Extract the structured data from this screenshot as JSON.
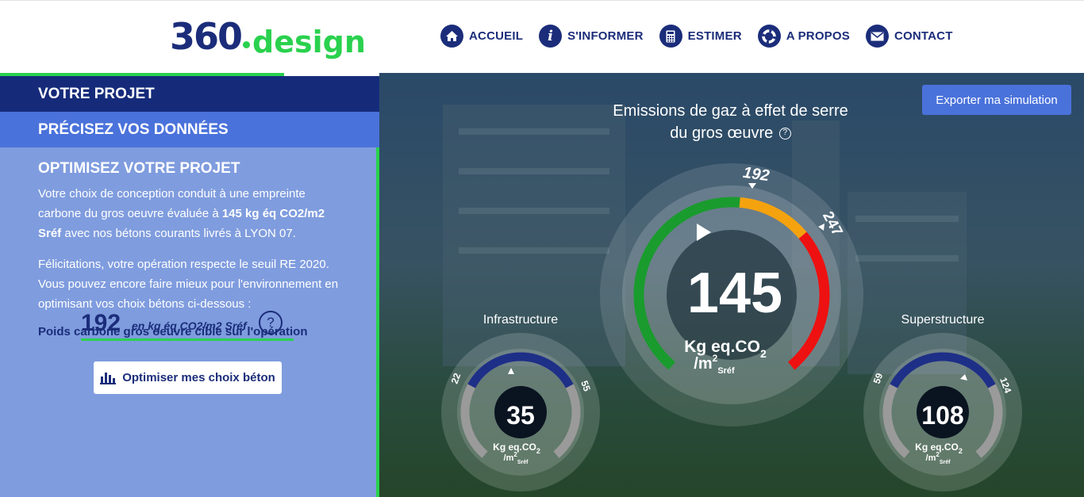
{
  "header": {
    "logo_number": "360",
    "logo_word": "design",
    "nav": [
      {
        "label": "ACCUEIL",
        "icon": "home-icon"
      },
      {
        "label": "S'INFORMER",
        "icon": "info-icon"
      },
      {
        "label": "ESTIMER",
        "icon": "calculator-icon"
      },
      {
        "label": "A PROPOS",
        "icon": "lifebuoy-icon"
      },
      {
        "label": "CONTACT",
        "icon": "mail-icon"
      }
    ]
  },
  "left": {
    "step1": "VOTRE PROJET",
    "step2": "PRÉCISEZ VOS DONNÉES",
    "opt_title": "OPTIMISEZ VOTRE PROJET",
    "p1_a": "Votre choix de conception conduit à une empreinte carbone du gros oeuvre évaluée à ",
    "p1_b": "145 kg éq CO2/m2 Sréf",
    "p1_c": " avec nos bétons courants livrés à LYON 07.",
    "p2": "Félicitations, votre opération respecte le seuil RE 2020. Vous pouvez encore faire mieux pour l'environnement en optimisant vos choix bétons ci-dessous :",
    "cible_label": "Poids carbone gros oeuvre cible sur l'opération",
    "cible_value": "192",
    "cible_unit": "en kg éq CO2/m2 Sréf",
    "help": "?",
    "optim_button": "Optimiser mes choix béton"
  },
  "right": {
    "export_button": "Exporter ma simulation",
    "title_line1": "Emissions de gaz à effet de serre",
    "title_line2": "du gros œuvre",
    "help_small": "?",
    "main_gauge": {
      "value": "145",
      "unit": "Kg eq.CO",
      "unit_sub": "2",
      "unit2": "/m",
      "unit2_sup": "2",
      "unit2_sub": "Sréf",
      "threshold_1": "192",
      "threshold_2": "247",
      "colors": {
        "green": "#1a9b2e",
        "orange": "#f5a20f",
        "red": "#ee1111"
      }
    },
    "infra": {
      "label": "Infrastructure",
      "value": "35",
      "low": "22",
      "high": "55",
      "unit": "Kg eq.CO",
      "unit_sub": "2",
      "unit2": "/m",
      "unit2_sup": "2",
      "unit2_sub": "Sréf"
    },
    "super": {
      "label": "Superstructure",
      "value": "108",
      "low": "59",
      "high": "124",
      "unit": "Kg eq.CO",
      "unit_sub": "2",
      "unit2": "/m",
      "unit2_sup": "2",
      "unit2_sub": "Sréf"
    }
  }
}
